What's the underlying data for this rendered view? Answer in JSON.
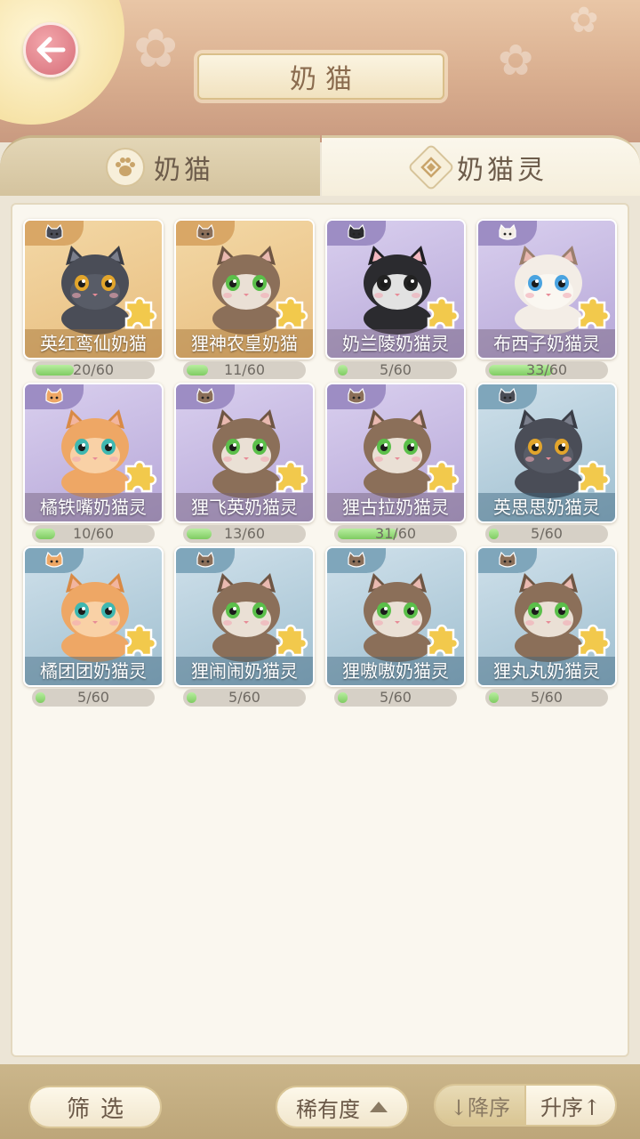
{
  "header": {
    "title": "奶猫"
  },
  "tabs": [
    {
      "label": "奶猫",
      "icon": "paw-icon",
      "active": false
    },
    {
      "label": "奶猫灵",
      "icon": "diamond-emblem-icon",
      "active": true
    }
  ],
  "cards": [
    {
      "name": "英红鸾仙奶猫",
      "progress": "20/60",
      "fraction": 0.333,
      "rarity": "gold",
      "cat": "gray-black"
    },
    {
      "name": "狸神农皇奶猫",
      "progress": "11/60",
      "fraction": 0.183,
      "rarity": "gold",
      "cat": "tabby"
    },
    {
      "name": "奶兰陵奶猫灵",
      "progress": "5/60",
      "fraction": 0.083,
      "rarity": "purple",
      "cat": "black-white"
    },
    {
      "name": "布西子奶猫灵",
      "progress": "33/60",
      "fraction": 0.55,
      "rarity": "purple",
      "cat": "ragdoll"
    },
    {
      "name": "橘铁嘴奶猫灵",
      "progress": "10/60",
      "fraction": 0.167,
      "rarity": "purple",
      "cat": "orange"
    },
    {
      "name": "狸飞英奶猫灵",
      "progress": "13/60",
      "fraction": 0.217,
      "rarity": "purple",
      "cat": "tabby"
    },
    {
      "name": "狸古拉奶猫灵",
      "progress": "31/60",
      "fraction": 0.517,
      "rarity": "purple",
      "cat": "tabby"
    },
    {
      "name": "英思思奶猫灵",
      "progress": "5/60",
      "fraction": 0.083,
      "rarity": "blue",
      "cat": "gray-black"
    },
    {
      "name": "橘团团奶猫灵",
      "progress": "5/60",
      "fraction": 0.083,
      "rarity": "blue",
      "cat": "orange"
    },
    {
      "name": "狸闹闹奶猫灵",
      "progress": "5/60",
      "fraction": 0.083,
      "rarity": "blue",
      "cat": "tabby"
    },
    {
      "name": "狸嗷嗷奶猫灵",
      "progress": "5/60",
      "fraction": 0.083,
      "rarity": "blue",
      "cat": "tabby"
    },
    {
      "name": "狸丸丸奶猫灵",
      "progress": "5/60",
      "fraction": 0.083,
      "rarity": "blue",
      "cat": "tabby"
    }
  ],
  "toolbar": {
    "filter_label": "筛选",
    "rarity_label": "稀有度",
    "sort_desc_label": "↓降序",
    "sort_asc_label": "升序↑"
  },
  "colors": {
    "progress_fill": "#7fcc62",
    "gold_card": "#e8bd7e",
    "purple_card": "#b6a7d8",
    "blue_card": "#9fbfd0"
  }
}
